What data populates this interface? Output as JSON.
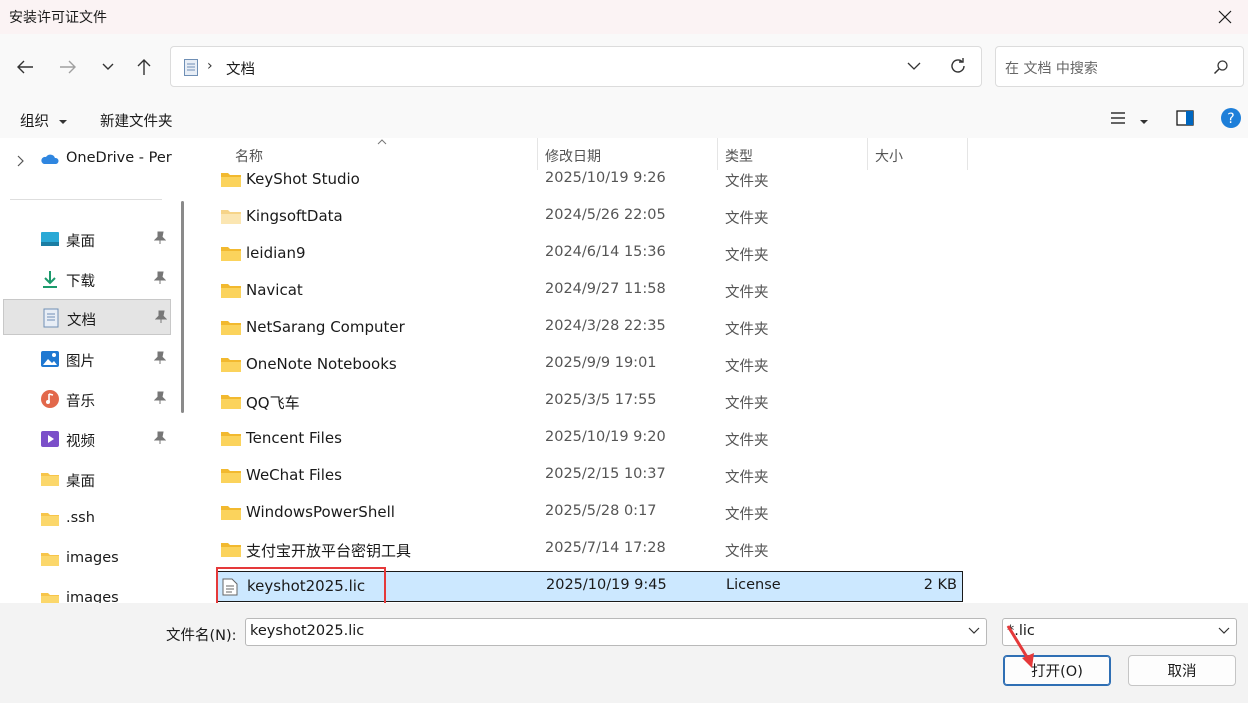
{
  "window": {
    "title": "安装许可证文件"
  },
  "nav": {
    "breadcrumb": "文档",
    "search_placeholder": "在 文档 中搜索"
  },
  "toolbar": {
    "organize_label": "组织",
    "new_folder_label": "新建文件夹"
  },
  "sidebar": {
    "items": [
      {
        "label": "OneDrive - Per",
        "icon": "onedrive-icon"
      },
      {
        "label": "桌面",
        "icon": "desktop-icon",
        "pinned": true
      },
      {
        "label": "下载",
        "icon": "download-icon",
        "pinned": true
      },
      {
        "label": "文档",
        "icon": "documents-icon",
        "pinned": true,
        "selected": true
      },
      {
        "label": "图片",
        "icon": "pictures-icon",
        "pinned": true
      },
      {
        "label": "音乐",
        "icon": "music-icon",
        "pinned": true
      },
      {
        "label": "视频",
        "icon": "videos-icon",
        "pinned": true
      },
      {
        "label": "桌面",
        "icon": "folder-icon"
      },
      {
        "label": ".ssh",
        "icon": "folder-icon"
      },
      {
        "label": "images",
        "icon": "folder-icon"
      },
      {
        "label": "images",
        "icon": "folder-icon"
      }
    ]
  },
  "columns": {
    "name": "名称",
    "modified": "修改日期",
    "type": "类型",
    "size": "大小"
  },
  "files": [
    {
      "name": "KeyShot Studio",
      "date": "2025/10/19 9:26",
      "type": "文件夹",
      "size": ""
    },
    {
      "name": "KingsoftData",
      "date": "2024/5/26 22:05",
      "type": "文件夹",
      "size": ""
    },
    {
      "name": "leidian9",
      "date": "2024/6/14 15:36",
      "type": "文件夹",
      "size": ""
    },
    {
      "name": "Navicat",
      "date": "2024/9/27 11:58",
      "type": "文件夹",
      "size": ""
    },
    {
      "name": "NetSarang Computer",
      "date": "2024/3/28 22:35",
      "type": "文件夹",
      "size": ""
    },
    {
      "name": "OneNote Notebooks",
      "date": "2025/9/9 19:01",
      "type": "文件夹",
      "size": ""
    },
    {
      "name": "QQ飞车",
      "date": "2025/3/5 17:55",
      "type": "文件夹",
      "size": ""
    },
    {
      "name": "Tencent Files",
      "date": "2025/10/19 9:20",
      "type": "文件夹",
      "size": ""
    },
    {
      "name": "WeChat Files",
      "date": "2025/2/15 10:37",
      "type": "文件夹",
      "size": ""
    },
    {
      "name": "WindowsPowerShell",
      "date": "2025/5/28 0:17",
      "type": "文件夹",
      "size": ""
    },
    {
      "name": "支付宝开放平台密钥工具",
      "date": "2025/7/14 17:28",
      "type": "文件夹",
      "size": ""
    },
    {
      "name": "keyshot2025.lic",
      "date": "2025/10/19 9:45",
      "type": "License",
      "size": "2 KB",
      "selected": true
    }
  ],
  "footer": {
    "filename_label": "文件名(N):",
    "filename_value": "keyshot2025.lic",
    "filter_value": "*.lic",
    "open_label": "打开(O)",
    "cancel_label": "取消"
  },
  "colors": {
    "selection": "#cce8ff",
    "highlight_box": "#e5393a",
    "folder": "#f7c54a",
    "accent": "#0067c0"
  }
}
